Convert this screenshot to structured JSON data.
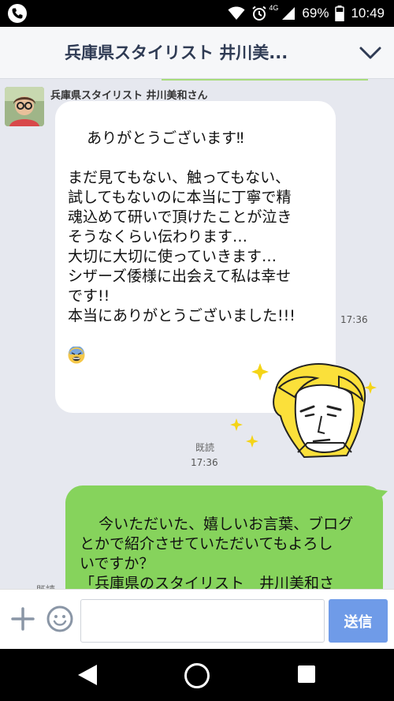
{
  "status_bar": {
    "network": "4G",
    "battery": "69%",
    "time": "10:49"
  },
  "header": {
    "title": "兵庫県スタイリスト 井川美..."
  },
  "messages": {
    "incoming": {
      "sender": "兵庫県スタイリスト 井川美和さん",
      "text": "ありがとうございます‼\n\nまだ見てもない、触ってもない、\n試してもないのに本当に丁寧で精\n魂込めて研いで頂けたことが泣き\nそうなくらい伝わります…\n大切に大切に使っていきます…\nシザーズ倭様に出会えて私は幸せ\nです!!\n本当にありがとうございました!!!",
      "time": "17:36"
    },
    "sticker": {
      "read_label": "既読",
      "time": "17:36"
    },
    "outgoing": {
      "text": "今いただいた、嬉しいお言葉、ブログ\nとかで紹介させていただいてもよろし\nいですか？\n「兵庫県のスタイリスト　井川美和さ\nんから嬉しいお言葉いただきました」",
      "read_label": "既読"
    }
  },
  "input_bar": {
    "placeholder": "",
    "send_label": "送信"
  },
  "colors": {
    "outgoing_bubble": "#86d35c",
    "send_button": "#6f9be8",
    "header_title": "#2f3b54"
  },
  "icons": [
    "phone-icon",
    "wifi-icon",
    "alarm-icon",
    "signal-icon",
    "battery-icon",
    "chevron-down-icon",
    "plus-icon",
    "emoji-icon",
    "back-icon",
    "home-icon",
    "recent-apps-icon"
  ]
}
